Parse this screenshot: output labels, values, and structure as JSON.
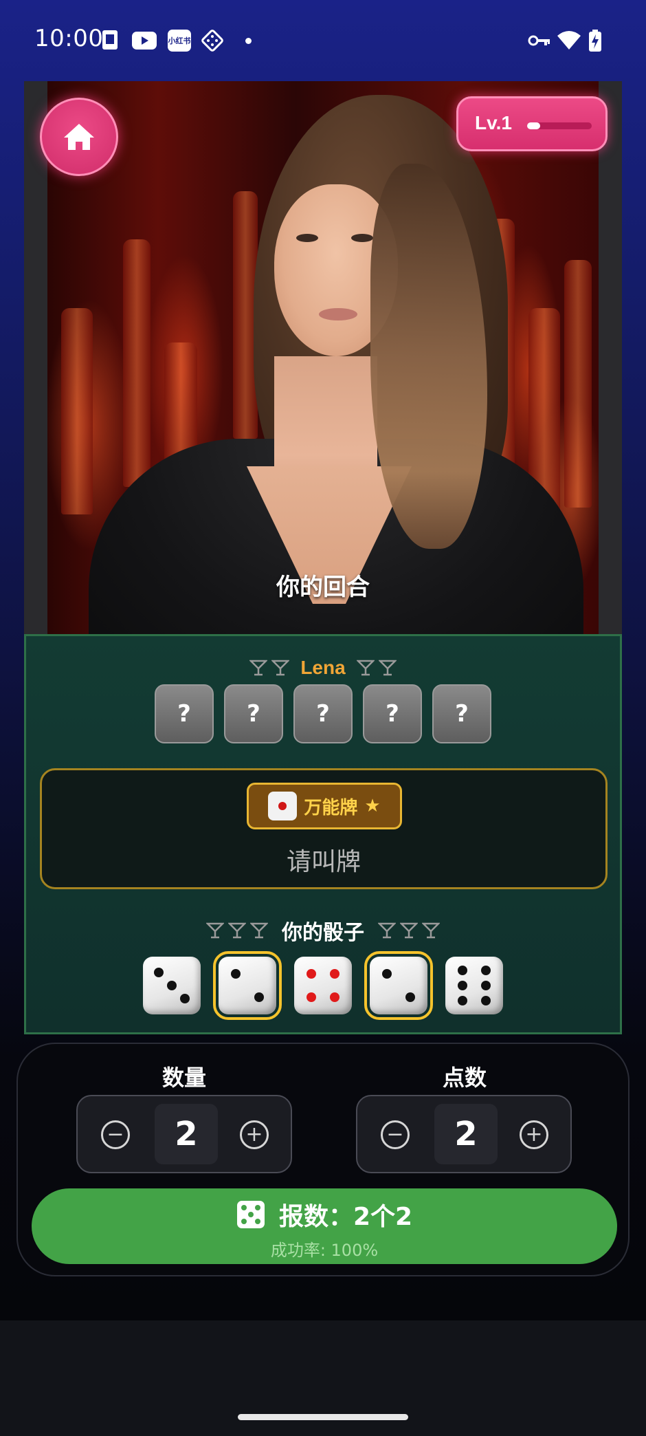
{
  "status_bar": {
    "time": "10:00",
    "icons": [
      "sim-icon",
      "youtube-icon",
      "xiaohongshu-icon",
      "dice-app-icon",
      "vpn-key-icon",
      "wifi-icon",
      "battery-charging-icon"
    ],
    "app_badge_text": "小红书"
  },
  "header": {
    "level_label": "Lv.1",
    "level_progress": 0.2
  },
  "portrait": {
    "turn_text": "你的回合"
  },
  "opponent": {
    "name": "Lena",
    "hidden_dice": [
      "?",
      "?",
      "?",
      "?",
      "?"
    ]
  },
  "call_box": {
    "wild_label": "万能牌",
    "wild_icon": "star-icon",
    "prompt": "请叫牌"
  },
  "player": {
    "label": "你的骰子",
    "dice": [
      {
        "value": 3,
        "selected": false
      },
      {
        "value": 2,
        "selected": true
      },
      {
        "value": 4,
        "selected": false
      },
      {
        "value": 2,
        "selected": true
      },
      {
        "value": 6,
        "selected": false
      }
    ]
  },
  "controls": {
    "quantity_label": "数量",
    "quantity_value": "2",
    "face_label": "点数",
    "face_value": "2",
    "submit_label": "报数：2个2",
    "submit_sub": "成功率: 100%"
  },
  "colors": {
    "accent_pink": "#e0366f",
    "submit_green": "#43a347",
    "table_green": "#133b33",
    "gold": "#e8b632"
  }
}
